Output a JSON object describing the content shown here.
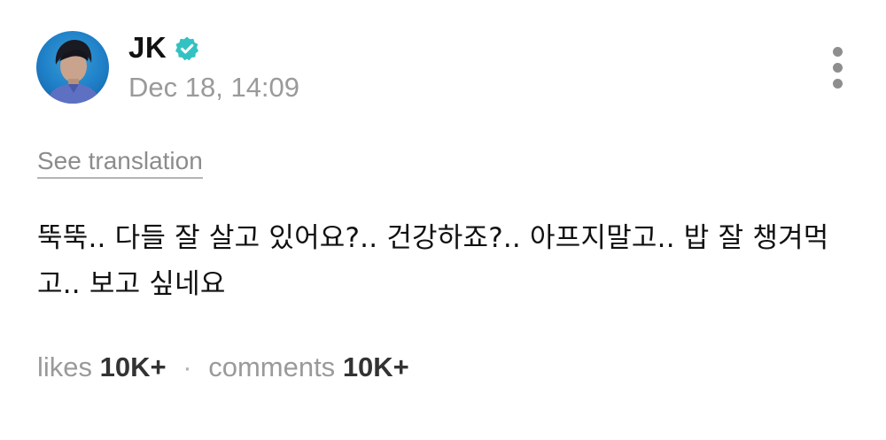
{
  "author": {
    "name": "JK",
    "timestamp": "Dec 18, 14:09",
    "verified": true,
    "avatar_icon": "profile-photo",
    "verified_icon": "verified-badge-icon"
  },
  "menu": {
    "icon": "more-vertical-icon"
  },
  "translation": {
    "label": "See translation"
  },
  "post": {
    "text": "뚝뚝.. 다들 잘 살고 있어요?.. 건강하죠?.. 아프지말고.. 밥 잘 챙겨먹고.. 보고 싶네요"
  },
  "stats": {
    "likes_label": "likes",
    "likes_count": "10K+",
    "separator": "·",
    "comments_label": "comments",
    "comments_count": "10K+"
  },
  "colors": {
    "verified": "#33c2c2",
    "muted_text": "#9a9a9a",
    "primary_text": "#111111",
    "avatar_bg": "#1e7fc7"
  }
}
